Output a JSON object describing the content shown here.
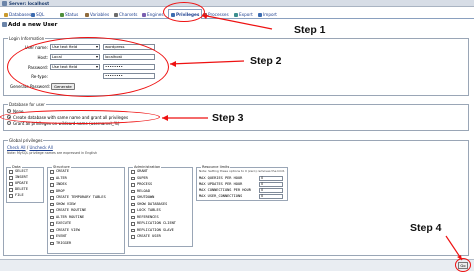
{
  "server": {
    "label": "Server: localhost"
  },
  "tabs": [
    {
      "label": "Databases",
      "icon": "databases-icon",
      "color": "#c99a2e"
    },
    {
      "label": "SQL",
      "icon": "sql-icon",
      "color": "#3c6cb0"
    },
    {
      "label": "Status",
      "icon": "status-icon",
      "color": "#4f8f3c"
    },
    {
      "label": "Variables",
      "icon": "variables-icon",
      "color": "#8f6b3c"
    },
    {
      "label": "Charsets",
      "icon": "charsets-icon",
      "color": "#6b6b6b"
    },
    {
      "label": "Engines",
      "icon": "engines-icon",
      "color": "#7a5fb0"
    },
    {
      "label": "Privileges",
      "icon": "privileges-icon",
      "color": "#3c6cb0"
    },
    {
      "label": "Processes",
      "icon": "processes-icon",
      "color": "#b03c3c"
    },
    {
      "label": "Export",
      "icon": "export-icon",
      "color": "#3c8f8f"
    },
    {
      "label": "Import",
      "icon": "import-icon",
      "color": "#3c6cb0"
    }
  ],
  "page_title": "Add a new User",
  "login": {
    "legend": "Login Information",
    "user_name_label": "User name:",
    "user_name_type": "Use text field",
    "user_name_value": "wordpress",
    "host_label": "Host:",
    "host_type": "Local",
    "host_value": "localhost",
    "password_label": "Password:",
    "password_type": "Use text field",
    "password_value": "••••••••",
    "retype_label": "Re-type:",
    "retype_value": "••••••••",
    "generate_label": "Generate Password:",
    "generate_button": "Generate"
  },
  "database": {
    "legend": "Database for user",
    "none": "None",
    "create": "Create database with same name and grant all privileges",
    "wildcard": "Grant all privileges on wildcard name (username\\_%)"
  },
  "global": {
    "legend": "Global privileges",
    "check_all": "Check All",
    "separator": " / ",
    "uncheck_all": "Uncheck All",
    "note": "Note: MySQL privilege names are expressed in English",
    "data_legend": "Data",
    "data": [
      "SELECT",
      "INSERT",
      "UPDATE",
      "DELETE",
      "FILE"
    ],
    "structure_legend": "Structure",
    "structure": [
      "CREATE",
      "ALTER",
      "INDEX",
      "DROP",
      "CREATE TEMPORARY TABLES",
      "SHOW VIEW",
      "CREATE ROUTINE",
      "ALTER ROUTINE",
      "EXECUTE",
      "CREATE VIEW",
      "EVENT",
      "TRIGGER"
    ],
    "admin_legend": "Administration",
    "admin": [
      "GRANT",
      "SUPER",
      "PROCESS",
      "RELOAD",
      "SHUTDOWN",
      "SHOW DATABASES",
      "LOCK TABLES",
      "REFERENCES",
      "REPLICATION CLIENT",
      "REPLICATION SLAVE",
      "CREATE USER"
    ],
    "limits_legend": "Resource limits",
    "limits_note": "Note: Setting these options to 0 (zero) removes the limit.",
    "limits": [
      {
        "label": "MAX QUERIES PER HOUR",
        "value": "0"
      },
      {
        "label": "MAX UPDATES PER HOUR",
        "value": "0"
      },
      {
        "label": "MAX CONNECTIONS PER HOUR",
        "value": "0"
      },
      {
        "label": "MAX USER_CONNECTIONS",
        "value": "0"
      }
    ]
  },
  "go_button": "Go",
  "annotations": {
    "step1": "Step 1",
    "step2": "Step 2",
    "step3": "Step 3",
    "step4": "Step 4",
    "color": "#ee1111"
  }
}
